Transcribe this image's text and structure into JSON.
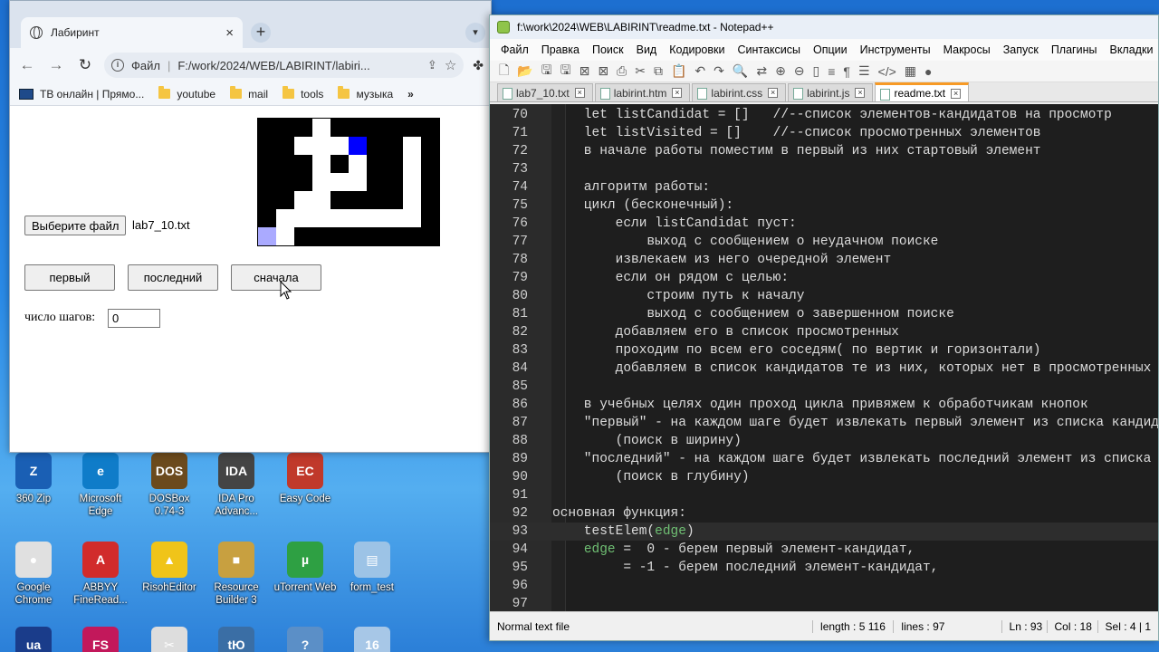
{
  "desktop": {
    "icons": [
      {
        "label": "360 Zip",
        "color": "#1a5fb4",
        "glyph": "Z"
      },
      {
        "label": "Microsoft Edge",
        "color": "#0f7cc9",
        "glyph": "e"
      },
      {
        "label": "DOSBox 0.74-3",
        "color": "#6b4a1d",
        "glyph": "DOS"
      },
      {
        "label": "IDA Pro Advanc...",
        "color": "#444444",
        "glyph": "IDA"
      },
      {
        "label": "Easy Code",
        "color": "#c0392b",
        "glyph": "EC"
      },
      {
        "label": "Google Chrome",
        "color": "#e0e0e0",
        "glyph": "●"
      },
      {
        "label": "ABBYY FineRead...",
        "color": "#d12b2b",
        "glyph": "A"
      },
      {
        "label": "RisohEditor",
        "color": "#f0c419",
        "glyph": "▲"
      },
      {
        "label": "Resource Builder 3",
        "color": "#c8a040",
        "glyph": "■"
      },
      {
        "label": "uTorrent Web",
        "color": "#2ea043",
        "glyph": "µ"
      },
      {
        "label": "form_test",
        "color": "#9cc3e6",
        "glyph": "▤"
      },
      {
        "label": "",
        "color": "#1a3c8a",
        "glyph": "ua"
      },
      {
        "label": "",
        "color": "#c2185b",
        "glyph": "FS"
      },
      {
        "label": "",
        "color": "#dddddd",
        "glyph": "✂"
      },
      {
        "label": "",
        "color": "#3a6ea5",
        "glyph": "tЮ"
      },
      {
        "label": "",
        "color": "#5b8fc7",
        "glyph": "?"
      },
      {
        "label": "",
        "color": "#a7c7e7",
        "glyph": "16"
      }
    ]
  },
  "browser": {
    "tab_title": "Лабиринт",
    "tab_close": "×",
    "new_tab": "+",
    "address_prefix": "Файл",
    "address_url": "F:/work/2024/WEB/LABIRINT/labiri...",
    "bookmarks": [
      {
        "label": "ТВ онлайн | Прямо...",
        "icon": "tv-icon"
      },
      {
        "label": "youtube",
        "icon": "folder-icon"
      },
      {
        "label": "mail",
        "icon": "folder-icon"
      },
      {
        "label": "tools",
        "icon": "folder-icon"
      },
      {
        "label": "музыка",
        "icon": "folder-icon"
      }
    ],
    "bookmarks_more": "»"
  },
  "app": {
    "file_button": "Выберите файл",
    "file_name": "lab7_10.txt",
    "btn_first": "первый",
    "btn_last": "последний",
    "btn_reset": "сначала",
    "steps_label": "число шагов:",
    "steps_value": "0",
    "maze": {
      "wall_color": "#000000",
      "path_color": "#ffffff",
      "current_color": "#0000ff",
      "start_color": "#aaaaff"
    }
  },
  "notepad": {
    "title": "f:\\work\\2024\\WEB\\LABIRINT\\readme.txt - Notepad++",
    "menu": [
      "Файл",
      "Правка",
      "Поиск",
      "Вид",
      "Кодировки",
      "Синтаксисы",
      "Опции",
      "Инструменты",
      "Макросы",
      "Запуск",
      "Плагины",
      "Вкладки"
    ],
    "tabs": [
      {
        "label": "lab7_10.txt",
        "active": false
      },
      {
        "label": "labirint.htm",
        "active": false
      },
      {
        "label": "labirint.css",
        "active": false
      },
      {
        "label": "labirint.js",
        "active": false
      },
      {
        "label": "readme.txt",
        "active": true
      }
    ],
    "lines": [
      {
        "n": "70",
        "text": "    let listCandidat = []   //--список элементов-кандидатов на просмотр"
      },
      {
        "n": "71",
        "text": "    let listVisited = []    //--список просмотренных элементов"
      },
      {
        "n": "72",
        "text": "    в начале работы поместим в первый из них стартовый элемент"
      },
      {
        "n": "73",
        "text": ""
      },
      {
        "n": "74",
        "text": "    алгоритм работы:"
      },
      {
        "n": "75",
        "text": "    цикл (бесконечный):"
      },
      {
        "n": "76",
        "text": "        если listCandidat пуст:"
      },
      {
        "n": "77",
        "text": "            выход с сообщением о неудачном поиске"
      },
      {
        "n": "78",
        "text": "        извлекаем из него очередной элемент"
      },
      {
        "n": "79",
        "text": "        если он рядом с целью:"
      },
      {
        "n": "80",
        "text": "            строим путь к началу"
      },
      {
        "n": "81",
        "text": "            выход с сообщением о завершенном поиске"
      },
      {
        "n": "82",
        "text": "        добавляем его в список просмотренных"
      },
      {
        "n": "83",
        "text": "        проходим по всем его соседям( по вертик и горизонтали)"
      },
      {
        "n": "84",
        "text": "        добавляем в список кандидатов те из них, которых нет в просмотренных"
      },
      {
        "n": "85",
        "text": ""
      },
      {
        "n": "86",
        "text": "    в учебных целях один проход цикла привяжем к обработчикам кнопок"
      },
      {
        "n": "87",
        "text": "    \"первый\" - на каждом шаге будет извлекать первый элемент из списка кандидатов"
      },
      {
        "n": "88",
        "text": "        (поиск в ширину)"
      },
      {
        "n": "89",
        "text": "    \"последний\" - на каждом шаге будет извлекать последний элемент из списка кандидатов"
      },
      {
        "n": "90",
        "text": "        (поиск в глубину)"
      },
      {
        "n": "91",
        "text": ""
      },
      {
        "n": "92",
        "text": "основная функция:"
      },
      {
        "n": "93",
        "text": "    testElem(",
        "hl": "edge",
        "tail": ")"
      },
      {
        "n": "94",
        "pre": "    ",
        "hl": "edge",
        "tail": " =  0 - берем первый элемент-кандидат,"
      },
      {
        "n": "95",
        "text": "         = -1 - берем последний элемент-кандидат,"
      },
      {
        "n": "96",
        "text": ""
      },
      {
        "n": "97",
        "text": ""
      }
    ],
    "current_line": "93",
    "status": {
      "type": "Normal text file",
      "length": "length : 5 116",
      "lines": "lines : 97",
      "ln": "Ln : 93",
      "col": "Col : 18",
      "sel": "Sel : 4 | 1"
    }
  }
}
